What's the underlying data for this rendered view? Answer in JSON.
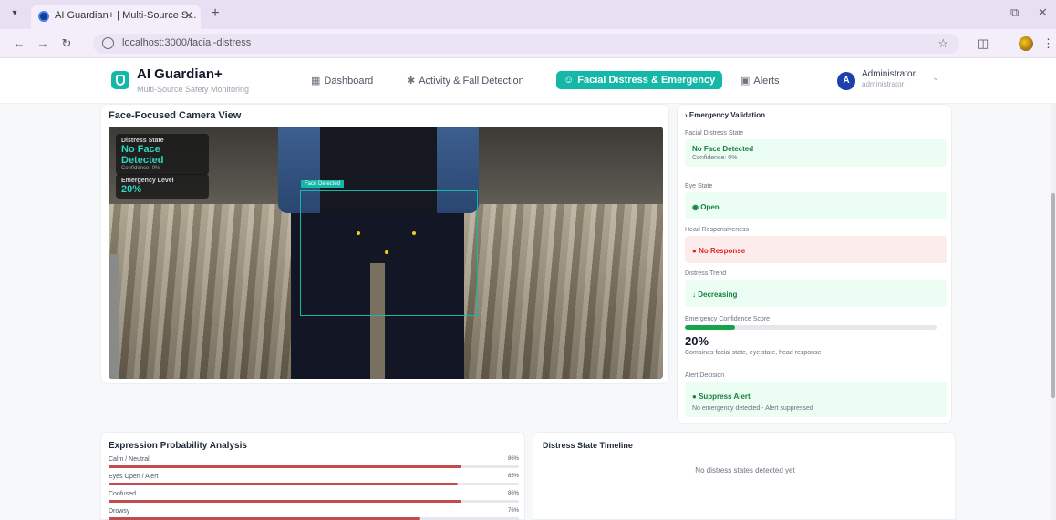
{
  "browser": {
    "tab_title": "AI Guardian+ | Multi-Source S...",
    "url": "localhost:3000/facial-distress"
  },
  "header": {
    "brand": "AI Guardian+",
    "subtitle": "Multi-Source Safety Monitoring",
    "nav": [
      {
        "label": "Dashboard",
        "icon": "grid-icon"
      },
      {
        "label": "Activity & Fall Detection",
        "icon": "person-walking-icon"
      },
      {
        "label": "Facial Distress & Emergency",
        "icon": "face-icon",
        "active": true
      },
      {
        "label": "Alerts",
        "icon": "calendar-icon"
      }
    ],
    "user": {
      "initial": "A",
      "name": "Administrator",
      "role": "administrator"
    }
  },
  "camera": {
    "title": "Face-Focused Camera View",
    "distress_label": "Distress State",
    "distress_value": "No Face Detected",
    "distress_confidence": "Confidence: 0%",
    "emergency_label": "Emergency Level",
    "emergency_value": "20%",
    "face_box_label": "Face Detected"
  },
  "validation": {
    "title": "Emergency Validation",
    "sections": [
      {
        "label": "Facial Distress State",
        "value": "No Face Detected",
        "sub": "Confidence: 0%",
        "tone": "green"
      },
      {
        "label": "Eye State",
        "value": "Open",
        "icon": "eye-icon",
        "tone": "green"
      },
      {
        "label": "Head Responsiveness",
        "value": "No Response",
        "icon": "dot-icon",
        "tone": "red"
      },
      {
        "label": "Distress Trend",
        "value": "Decreasing",
        "icon": "arrow-down-icon",
        "tone": "green"
      }
    ],
    "confidence": {
      "label": "Emergency Confidence Score",
      "value": 20,
      "display": "20%",
      "note": "Combines facial state, eye state, head response"
    },
    "decision": {
      "label": "Alert Decision",
      "value": "Suppress Alert",
      "sub": "No emergency detected - Alert suppressed"
    }
  },
  "expressions": {
    "title": "Expression Probability Analysis",
    "items": [
      {
        "label": "Calm / Neutral",
        "value": 86,
        "display": "86%"
      },
      {
        "label": "Eyes Open / Alert",
        "value": 85,
        "display": "85%"
      },
      {
        "label": "Confused",
        "value": 86,
        "display": "86%"
      },
      {
        "label": "Drowsy",
        "value": 76,
        "display": "76%"
      }
    ]
  },
  "timeline": {
    "title": "Distress State Timeline",
    "empty": "No distress states detected yet"
  },
  "colors": {
    "accent": "#14b8a6",
    "ok": "#15803d",
    "danger": "#dc2626",
    "bar": "#c44b4b"
  }
}
